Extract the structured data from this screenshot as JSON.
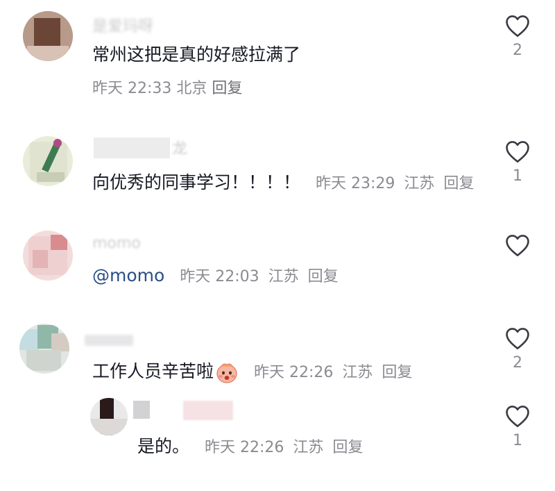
{
  "comments": [
    {
      "username": "是爱玛呀",
      "text": "常州这把是真的好感拉满了",
      "time": "昨天 22:33",
      "location": "北京",
      "reply_label": "回复",
      "likes": "2"
    },
    {
      "username": "龙",
      "text": "向优秀的同事学习！！！！",
      "time": "昨天 23:29",
      "location": "江苏",
      "reply_label": "回复",
      "likes": "1"
    },
    {
      "username": "momo",
      "text": "@momo",
      "time": "昨天 22:03",
      "location": "江苏",
      "reply_label": "回复",
      "likes": ""
    },
    {
      "username": "",
      "text": "工作人员辛苦啦",
      "emoji": "blushing-face-emoji",
      "time": "昨天 22:26",
      "location": "江苏",
      "reply_label": "回复",
      "likes": "2"
    }
  ],
  "reply": {
    "username": "",
    "text": "是的。",
    "time": "昨天 22:26",
    "location": "江苏",
    "reply_label": "回复",
    "likes": "1"
  },
  "icons": {
    "like": "heart-outline-icon"
  },
  "colors": {
    "text": "#161823",
    "meta": "#8a8b91",
    "mention": "#2b4f86"
  }
}
